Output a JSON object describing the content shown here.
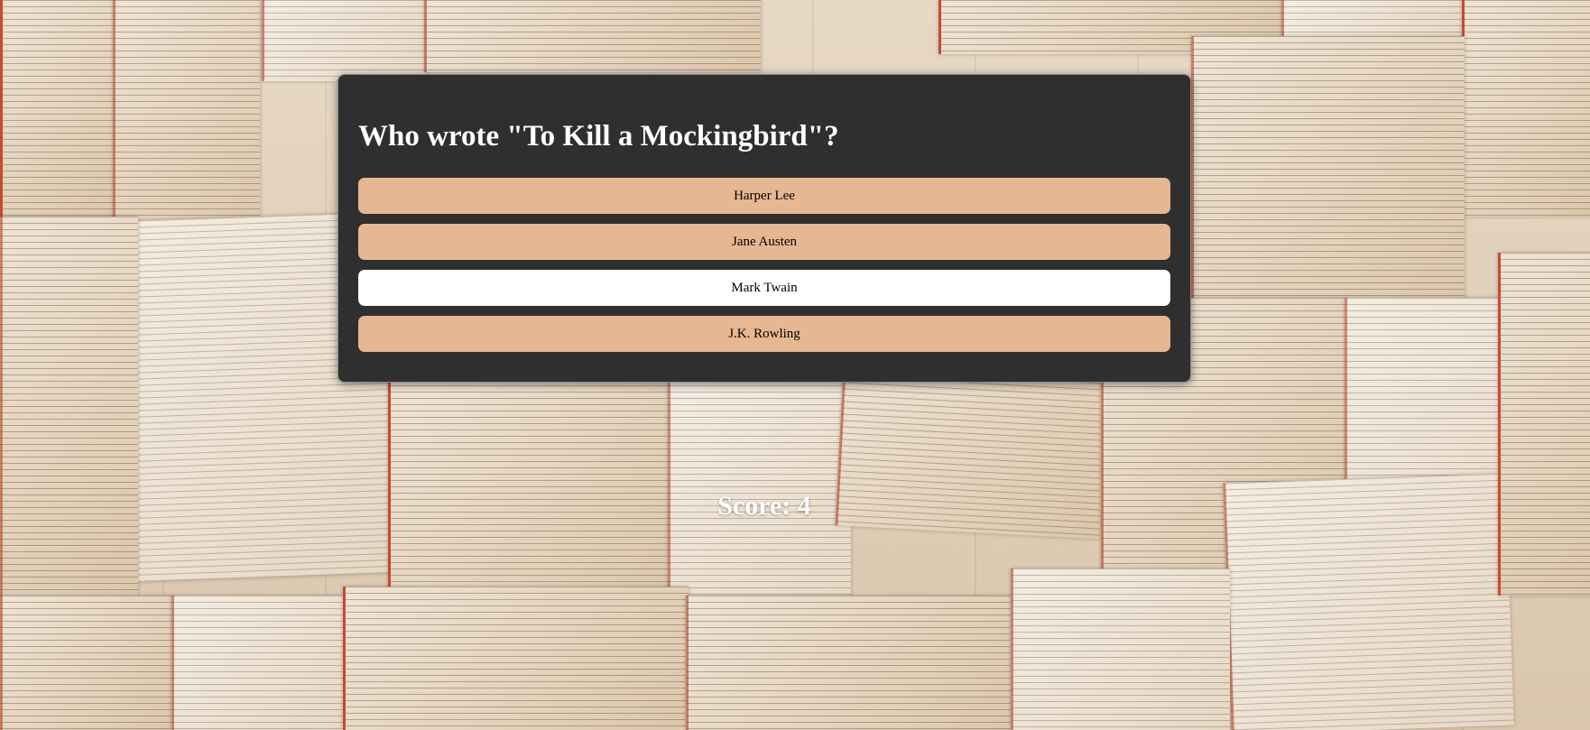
{
  "quiz": {
    "question": "Who wrote \"To Kill a Mockingbird\"?",
    "answers": [
      {
        "label": "Harper Lee"
      },
      {
        "label": "Jane Austen"
      },
      {
        "label": "Mark Twain"
      },
      {
        "label": "J.K. Rowling"
      }
    ],
    "hovered_answer": "Mark Twain"
  },
  "score": {
    "text": "Score: 4"
  },
  "colors": {
    "card_background": "#2f2f2f",
    "answer_button": "#e6b891",
    "answer_button_hover": "#ffffff",
    "question_text": "#ffffff",
    "score_text": "#ffffff"
  }
}
